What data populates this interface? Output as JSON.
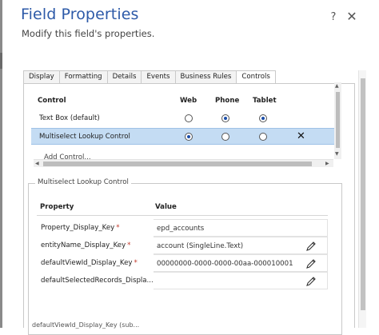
{
  "dialog": {
    "title": "Field Properties",
    "subtitle": "Modify this field's properties.",
    "help_glyph": "?",
    "close_glyph": "✕"
  },
  "tabs": [
    {
      "label": "Display",
      "active": false
    },
    {
      "label": "Formatting",
      "active": false
    },
    {
      "label": "Details",
      "active": false
    },
    {
      "label": "Events",
      "active": false
    },
    {
      "label": "Business Rules",
      "active": false
    },
    {
      "label": "Controls",
      "active": true
    }
  ],
  "controls": {
    "headers": {
      "control": "Control",
      "web": "Web",
      "phone": "Phone",
      "tablet": "Tablet"
    },
    "rows": [
      {
        "label": "Text Box (default)",
        "web": false,
        "phone": true,
        "tablet": true,
        "selected": false
      },
      {
        "label": "Multiselect Lookup Control",
        "web": true,
        "phone": false,
        "tablet": false,
        "selected": true,
        "remove_glyph": "✕"
      }
    ],
    "add_label": "Add Control..."
  },
  "properties": {
    "legend": "Multiselect Lookup Control",
    "headers": {
      "property": "Property",
      "value": "Value"
    },
    "rows": [
      {
        "label": "Property_Display_Key",
        "required": "*",
        "value": "epd_accounts",
        "editable": false
      },
      {
        "label": "entityName_Display_Key",
        "required": "*",
        "value": "account (SingleLine.Text)",
        "editable": true
      },
      {
        "label": "defaultViewId_Display_Key",
        "required": "*",
        "value": "00000000-0000-0000-00aa-000010001...",
        "editable": true
      },
      {
        "label": "defaultSelectedRecords_Displa...",
        "required": "",
        "value": "",
        "editable": true
      }
    ],
    "cut_off_text": "defaultViewId_Display_Key (sub..."
  },
  "colors": {
    "title": "#2d5aa8",
    "selected_row": "#c4dcf3",
    "radio_on": "#1a4da8",
    "required": "#c0392b"
  }
}
